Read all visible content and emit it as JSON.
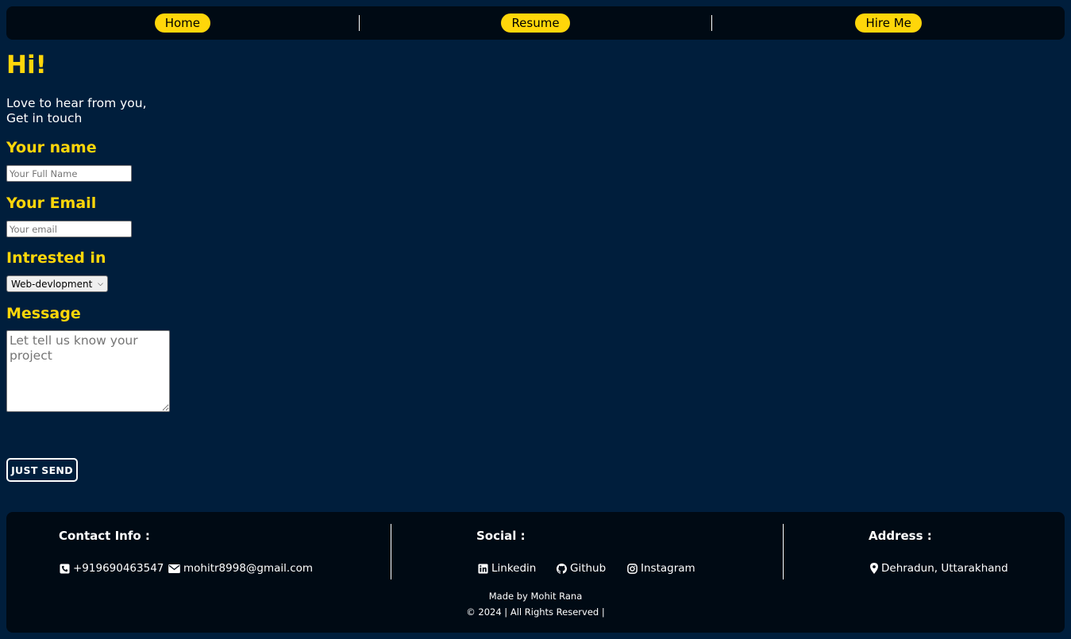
{
  "nav": {
    "items": [
      {
        "label": "Home"
      },
      {
        "label": "Resume"
      },
      {
        "label": "Hire Me"
      }
    ]
  },
  "main": {
    "greeting": "Hi!",
    "intro_line1": "Love to hear from you,",
    "intro_line2": "Get in touch",
    "name_label": "Your name",
    "name_placeholder": "Your Full Name",
    "email_label": "Your Email",
    "email_placeholder": "Your email",
    "interest_label": "Intrested in",
    "interest_selected": "Web-devlopment",
    "message_label": "Message",
    "message_placeholder": "Let tell us know your project",
    "send_label": "JUST SEND"
  },
  "footer": {
    "contact_title": "Contact Info :",
    "phone": "+919690463547",
    "email": "mohitr8998@gmail.com",
    "social_title": "Social :",
    "social_links": [
      {
        "label": "Linkedin",
        "icon": "linkedin-icon"
      },
      {
        "label": "Github",
        "icon": "github-icon"
      },
      {
        "label": "Instagram",
        "icon": "instagram-icon"
      }
    ],
    "address_title": "Address :",
    "address": "Dehradun, Uttarakhand",
    "made_by": "Made by Mohit Rana",
    "copyright": "© 2024 | All Rights Reserved |"
  },
  "colors": {
    "background": "#001e3c",
    "panel": "#000a14",
    "accent": "#ffd60a"
  }
}
